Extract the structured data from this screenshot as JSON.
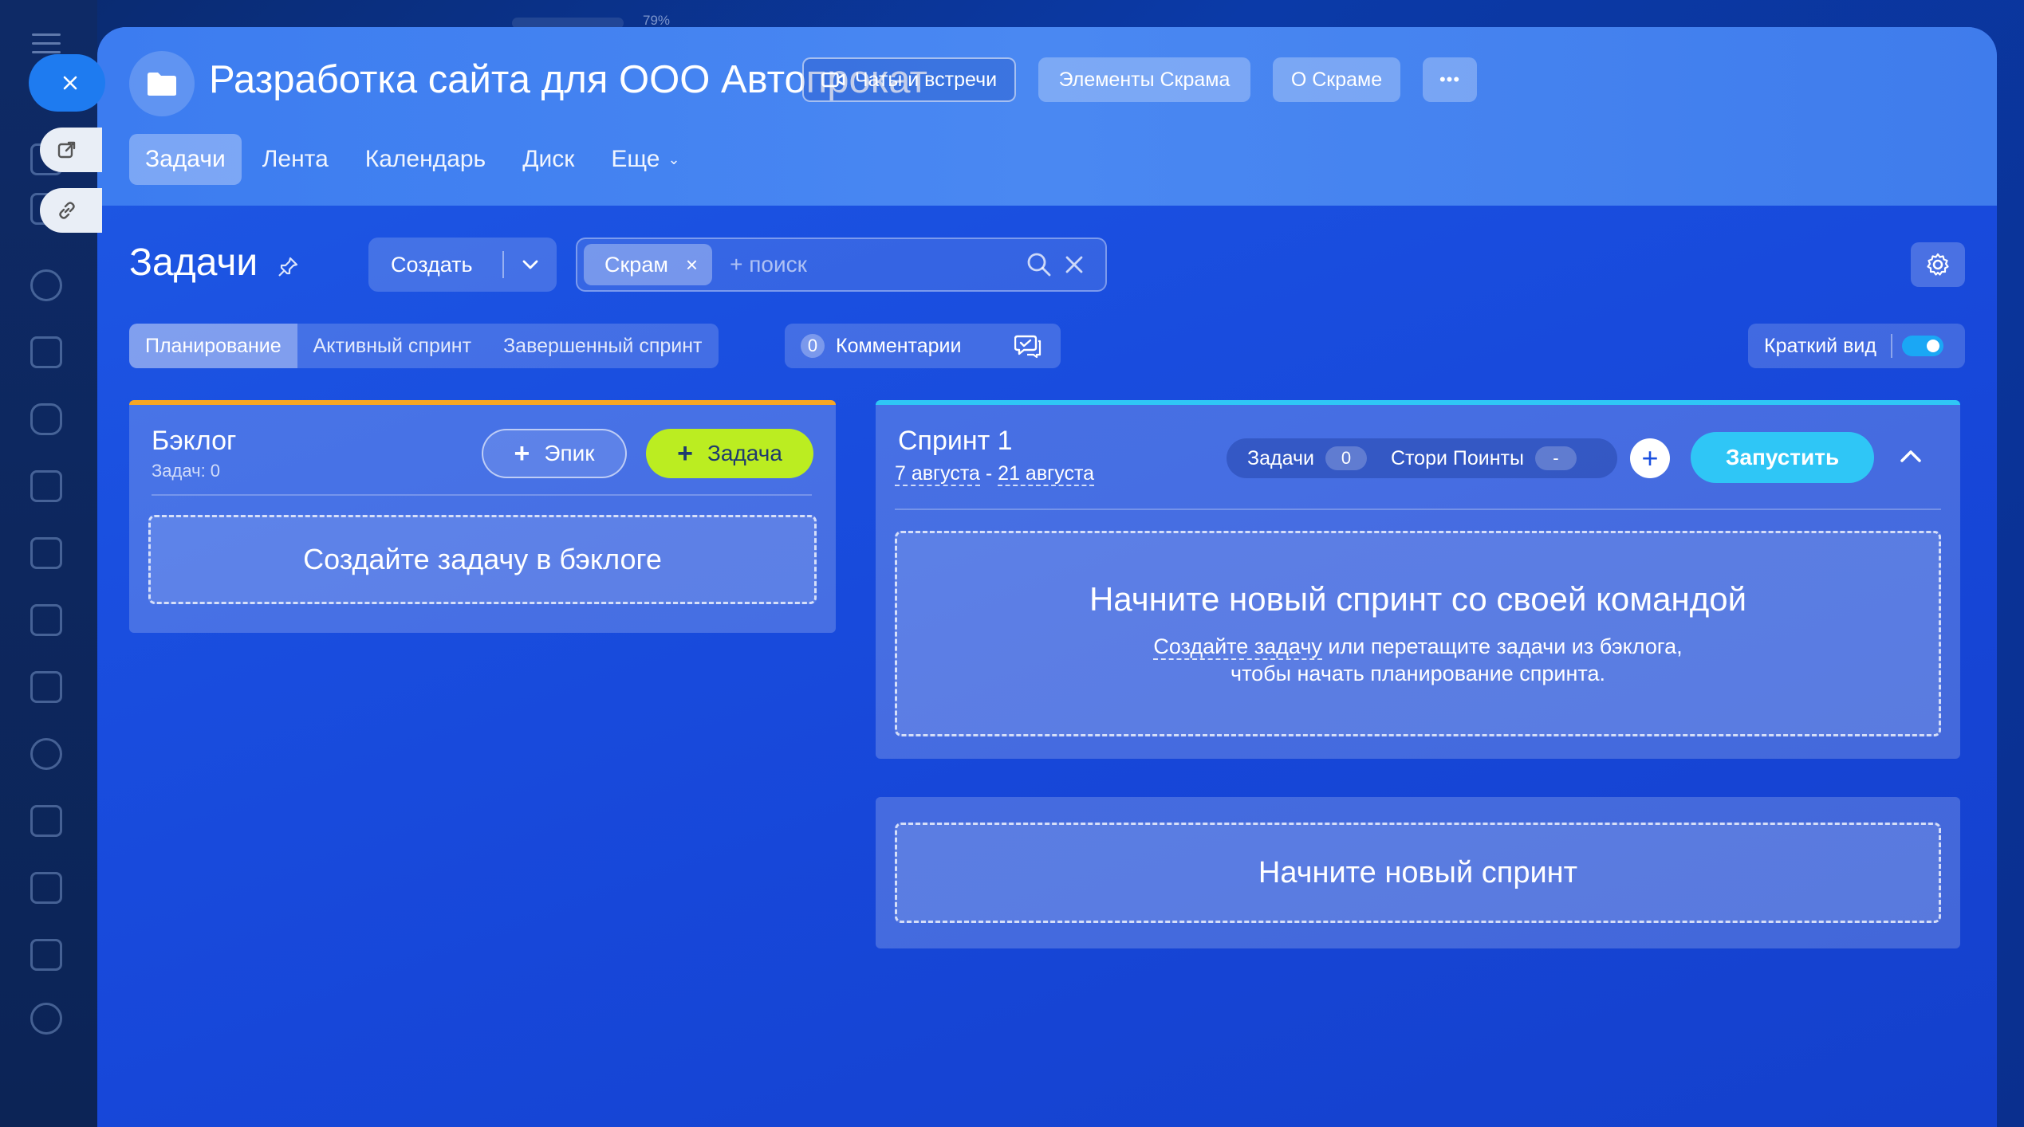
{
  "background": {
    "zoom_text": "79%"
  },
  "header": {
    "title": "Разработка сайта для ООО Автопрокат",
    "buttons": {
      "chats": "Чаты и встречи",
      "scrum_elements": "Элементы Скрама",
      "about_scrum": "О Скраме",
      "more": "•••"
    },
    "tabs": [
      {
        "label": "Задачи",
        "active": true
      },
      {
        "label": "Лента"
      },
      {
        "label": "Календарь"
      },
      {
        "label": "Диск"
      },
      {
        "label": "Еще"
      }
    ]
  },
  "toolbar": {
    "title": "Задачи",
    "create_label": "Создать",
    "search": {
      "chip": "Скрам",
      "placeholder": "+ поиск"
    }
  },
  "views": {
    "segments": [
      "Планирование",
      "Активный спринт",
      "Завершенный спринт"
    ],
    "comments_count": "0",
    "comments_label": "Комментарии",
    "compact_label": "Краткий вид"
  },
  "backlog": {
    "title": "Бэклог",
    "count_label": "Задач: 0",
    "epic_button": "Эпик",
    "task_button": "Задача",
    "empty_text": "Создайте задачу в бэклоге"
  },
  "sprint": {
    "title": "Спринт 1",
    "date_start": "7 августа",
    "date_sep": " - ",
    "date_end": "21 августа",
    "stats": {
      "tasks_label": "Задачи",
      "tasks_value": "0",
      "points_label": "Стори Поинты",
      "points_value": "-"
    },
    "start_button": "Запустить",
    "empty_title": "Начните новый спринт со своей командой",
    "empty_link": "Создайте задачу",
    "empty_text_1": " или перетащите задачи из бэклога,",
    "empty_text_2": "чтобы начать планирование спринта."
  },
  "new_sprint": {
    "label": "Начните новый спринт"
  },
  "colors": {
    "accent_green": "#bbed21",
    "accent_cyan": "#2fc6f6",
    "backlog_border": "#f6a623",
    "close_button": "#1e7bf0"
  }
}
